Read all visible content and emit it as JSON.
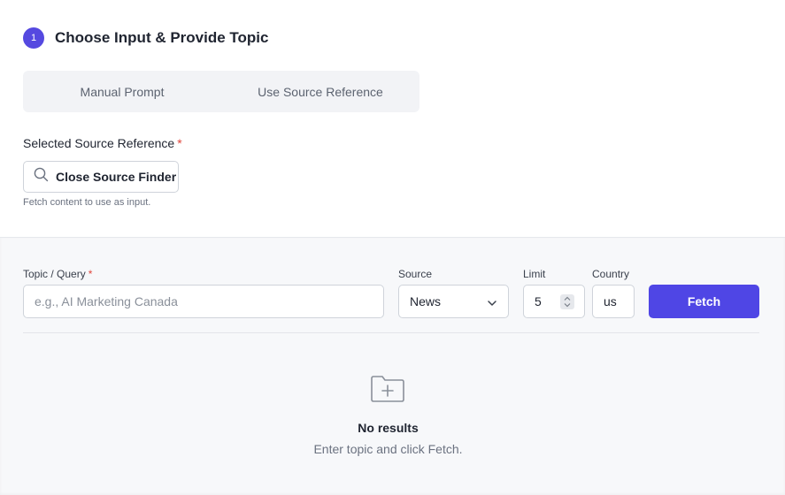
{
  "step": {
    "number": "1",
    "title": "Choose Input & Provide Topic"
  },
  "tabs": [
    {
      "label": "Manual Prompt"
    },
    {
      "label": "Use Source Reference"
    }
  ],
  "source_reference": {
    "label": "Selected Source Reference",
    "required_mark": "*",
    "button_label": "Close Source Finder",
    "help": "Fetch content to use as input."
  },
  "finder": {
    "topic_label": "Topic / Query",
    "topic_required_mark": "*",
    "topic_placeholder": "e.g., AI Marketing Canada",
    "source_label": "Source",
    "source_value": "News",
    "limit_label": "Limit",
    "limit_value": "5",
    "country_label": "Country",
    "country_value": "us",
    "fetch_label": "Fetch"
  },
  "empty_state": {
    "title": "No results",
    "subtitle": "Enter topic and click Fetch.",
    "icon": "folder-plus-icon"
  },
  "colors": {
    "accent": "#4f46e5",
    "required": "#e0453b"
  }
}
